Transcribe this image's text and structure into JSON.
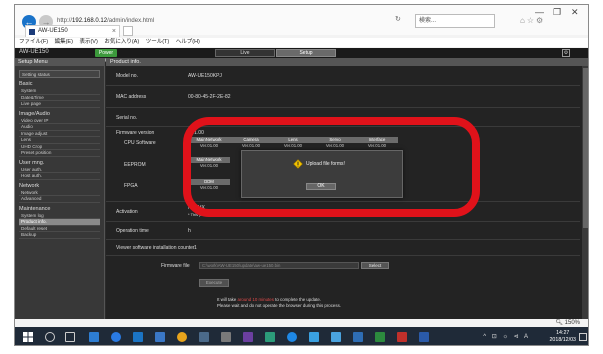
{
  "browser": {
    "url_prefix": "http://",
    "url_host": "192.168.0.12",
    "url_path": "/admin/index.html",
    "search_placeholder": "検索...",
    "tab_title": "AW-UE150",
    "tab_close": "×",
    "menu": [
      "ファイル(F)",
      "編集(E)",
      "表示(V)",
      "お気に入り(A)",
      "ツール(T)",
      "ヘルプ(H)"
    ],
    "back_icon": "←",
    "forward_icon": "→",
    "refresh_icon": "↻",
    "win_min": "—",
    "win_max": "❐",
    "win_close": "✕",
    "zoom": "150%"
  },
  "app": {
    "model": "AW-UE150",
    "power_badge": "Power ON",
    "live_tab": "Live",
    "setup_tab": "Setup",
    "setup_menu_title": "Setup Menu",
    "content_title": "Product info.",
    "sidebar": {
      "top_button": "Setting status",
      "groups": [
        {
          "title": "Basic",
          "items": [
            "System",
            "Date&Time",
            "Live page"
          ]
        },
        {
          "title": "Image/Audio",
          "items": [
            "Video over IP",
            "Audio",
            "Image adjust",
            "Lens",
            "UHD Crop",
            "Preset position"
          ]
        },
        {
          "title": "User mng.",
          "items": [
            "User auth.",
            "Host auth."
          ]
        },
        {
          "title": "Network",
          "items": [
            "Network",
            "Advanced"
          ]
        },
        {
          "title": "Maintenance",
          "items": [
            "System log",
            "Product info.",
            "Default reset",
            "Backup"
          ]
        }
      ]
    },
    "rows": {
      "model_no_label": "Model no.",
      "model_no_value": "AW-UE150KPJ",
      "mac_label": "MAC address",
      "mac_value": "00-80-45-2F-2E-82",
      "serial_label": "Serial no.",
      "serial_value": "",
      "firmware_label": "Firmware version",
      "firmware_value": "V01.00",
      "cpu_label": "CPU Software",
      "eeprom_label": "EEPROM",
      "fpga_label": "FPGA",
      "activation_label": "Activation",
      "activation_value": "NDI|HX",
      "activation_note": "* This product is compatible with NDI|HX technology of NewTek Inc.",
      "optime_label": "Operation time",
      "optime_value": "h",
      "viewer_label": "Viewer software installation counter",
      "viewer_value": "1"
    },
    "cpu_table": {
      "headers": [
        "MainNetwork",
        "Camera",
        "Lens",
        "Servo",
        "Interface"
      ],
      "values": [
        "Ver.01.00",
        "Ver.01.00",
        "Ver.01.00",
        "Ver.01.00",
        "Ver.01.00"
      ]
    },
    "eeprom_table": {
      "headers": [
        "MainNetwork"
      ],
      "values": [
        "Ver.01.00"
      ]
    },
    "fpga_table": {
      "headers": [
        "DDM"
      ],
      "values": [
        "Ver.01.00"
      ]
    },
    "firmware_file_label": "Firmware file",
    "firmware_file_placeholder": "C:\\work\\AW-UE150\\update\\aw-ue150.bin",
    "select_button": "Select",
    "execute_button": "Execute",
    "note_line1_pre": "It will take",
    "note_line1_hl": "around 10 minutes",
    "note_line1_post": "to complete the update.",
    "note_line2": "Please wait and do not operate the browser during this process."
  },
  "dialog": {
    "message": "Upload file forms!",
    "ok_label": "OK"
  },
  "taskbar": {
    "time": "14:27",
    "date": "2018/12/03",
    "tray": "^ ⊡ ☼ ⊲ A"
  },
  "colors": {
    "annotation_red": "#e0121a",
    "warning_yellow": "#f2c200",
    "browser_blue": "#1a73c9"
  }
}
